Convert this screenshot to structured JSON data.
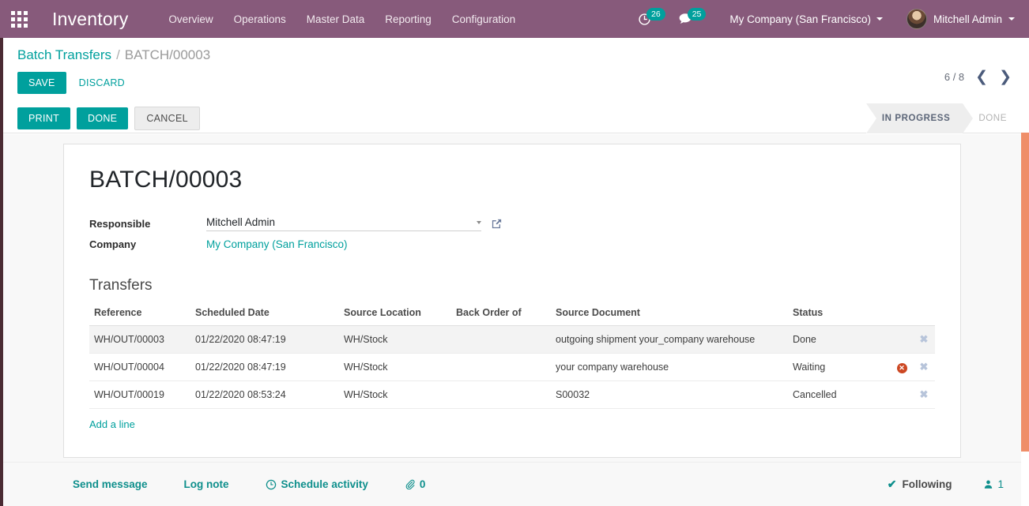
{
  "navbar": {
    "apps_icon": "apps-grid-icon",
    "brand": "Inventory",
    "menu": [
      "Overview",
      "Operations",
      "Master Data",
      "Reporting",
      "Configuration"
    ],
    "activity_icon": "clock-icon",
    "activity_count": "26",
    "messages_icon": "chat-bubble-icon",
    "messages_count": "25",
    "company": "My Company (San Francisco)",
    "user": "Mitchell Admin"
  },
  "breadcrumb": {
    "root": "Batch Transfers",
    "separator": "/",
    "current": "BATCH/00003"
  },
  "control_panel": {
    "save_label": "SAVE",
    "discard_label": "DISCARD",
    "pager_text": "6 / 8",
    "prev_icon": "chevron-left-icon",
    "next_icon": "chevron-right-icon"
  },
  "action_bar": {
    "buttons": [
      {
        "label": "PRINT",
        "style": "primary"
      },
      {
        "label": "DONE",
        "style": "primary"
      },
      {
        "label": "CANCEL",
        "style": "default"
      }
    ],
    "statuses": [
      {
        "label": "IN PROGRESS",
        "active": true
      },
      {
        "label": "DONE",
        "active": false
      }
    ]
  },
  "form": {
    "title": "BATCH/00003",
    "responsible_label": "Responsible",
    "responsible_value": "Mitchell Admin",
    "responsible_placeholder": "",
    "external_link_icon": "external-link-icon",
    "dropdown_icon": "caret-down-icon",
    "company_label": "Company",
    "company_value": "My Company (San Francisco)"
  },
  "transfers": {
    "section_title": "Transfers",
    "columns": [
      "Reference",
      "Scheduled Date",
      "Source Location",
      "Back Order of",
      "Source Document",
      "Status"
    ],
    "rows": [
      {
        "reference": "WH/OUT/00003",
        "scheduled_date": "01/22/2020 08:47:19",
        "source_location": "WH/Stock",
        "back_order_of": "",
        "source_document": "outgoing shipment your_company warehouse",
        "status": "Done",
        "alert": false,
        "highlight": true,
        "delete_icon": "close-icon"
      },
      {
        "reference": "WH/OUT/00004",
        "scheduled_date": "01/22/2020 08:47:19",
        "source_location": "WH/Stock",
        "back_order_of": "",
        "source_document": "your company warehouse",
        "status": "Waiting",
        "alert": true,
        "alert_icon": "error-circle-icon",
        "highlight": false,
        "delete_icon": "close-icon"
      },
      {
        "reference": "WH/OUT/00019",
        "scheduled_date": "01/22/2020 08:53:24",
        "source_location": "WH/Stock",
        "back_order_of": "",
        "source_document": "S00032",
        "status": "Cancelled",
        "alert": false,
        "highlight": false,
        "delete_icon": "close-icon"
      }
    ],
    "add_line_label": "Add a line"
  },
  "chatter": {
    "send_message": "Send message",
    "log_note": "Log note",
    "schedule_activity": "Schedule activity",
    "schedule_icon": "clock-icon",
    "attachment_icon": "paperclip-icon",
    "attachment_count": "0",
    "following_label": "Following",
    "following_icon": "check-icon",
    "followers_icon": "user-icon",
    "followers_count": "1"
  },
  "colors": {
    "brand_purple": "#875a7b",
    "accent_teal": "#00a09d",
    "scrollbar_orange": "#ef8e69",
    "alert_red": "#cc4722"
  }
}
